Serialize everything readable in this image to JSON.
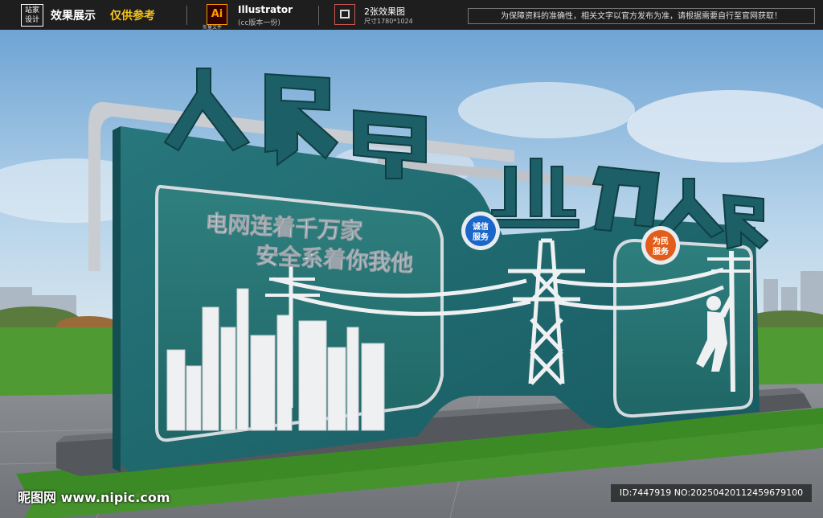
{
  "topbar": {
    "logo_line1": "站家",
    "logo_line2": "设计",
    "title_a": "效果展示",
    "title_b": "仅供参考",
    "ai_label": "Ai",
    "ai_sub": "矢量文件",
    "illustrator": "Illustrator",
    "illustrator_sub": "(cc版本一份)",
    "pictures": "2张效果图",
    "pictures_size": "尺寸1780*1024",
    "notice": "为保障资料的准确性，相关文字以官方发布为准，请根据需要自行至官网获取！"
  },
  "sign": {
    "headline_left": [
      "人",
      "民",
      "电"
    ],
    "headline_right": [
      "业",
      "为",
      "人",
      "民"
    ],
    "slogan_line1": "电网连着千万家",
    "slogan_line2": "安全系着你我他",
    "badge_left_line1": "诚信",
    "badge_left_line2": "服务",
    "badge_right_line1": "为民",
    "badge_right_line2": "服务"
  },
  "watermark": {
    "site": "昵图网 www.nipic.com",
    "id": "ID:7447919 NO:20250420112459679100"
  },
  "colors": {
    "panel": "#1f6a70",
    "panel_dark": "#134e54",
    "badge_blue": "#1a66c9",
    "badge_orange": "#e35d1a",
    "grass": "#3f8a2e",
    "sky": "#7fb0d8"
  }
}
